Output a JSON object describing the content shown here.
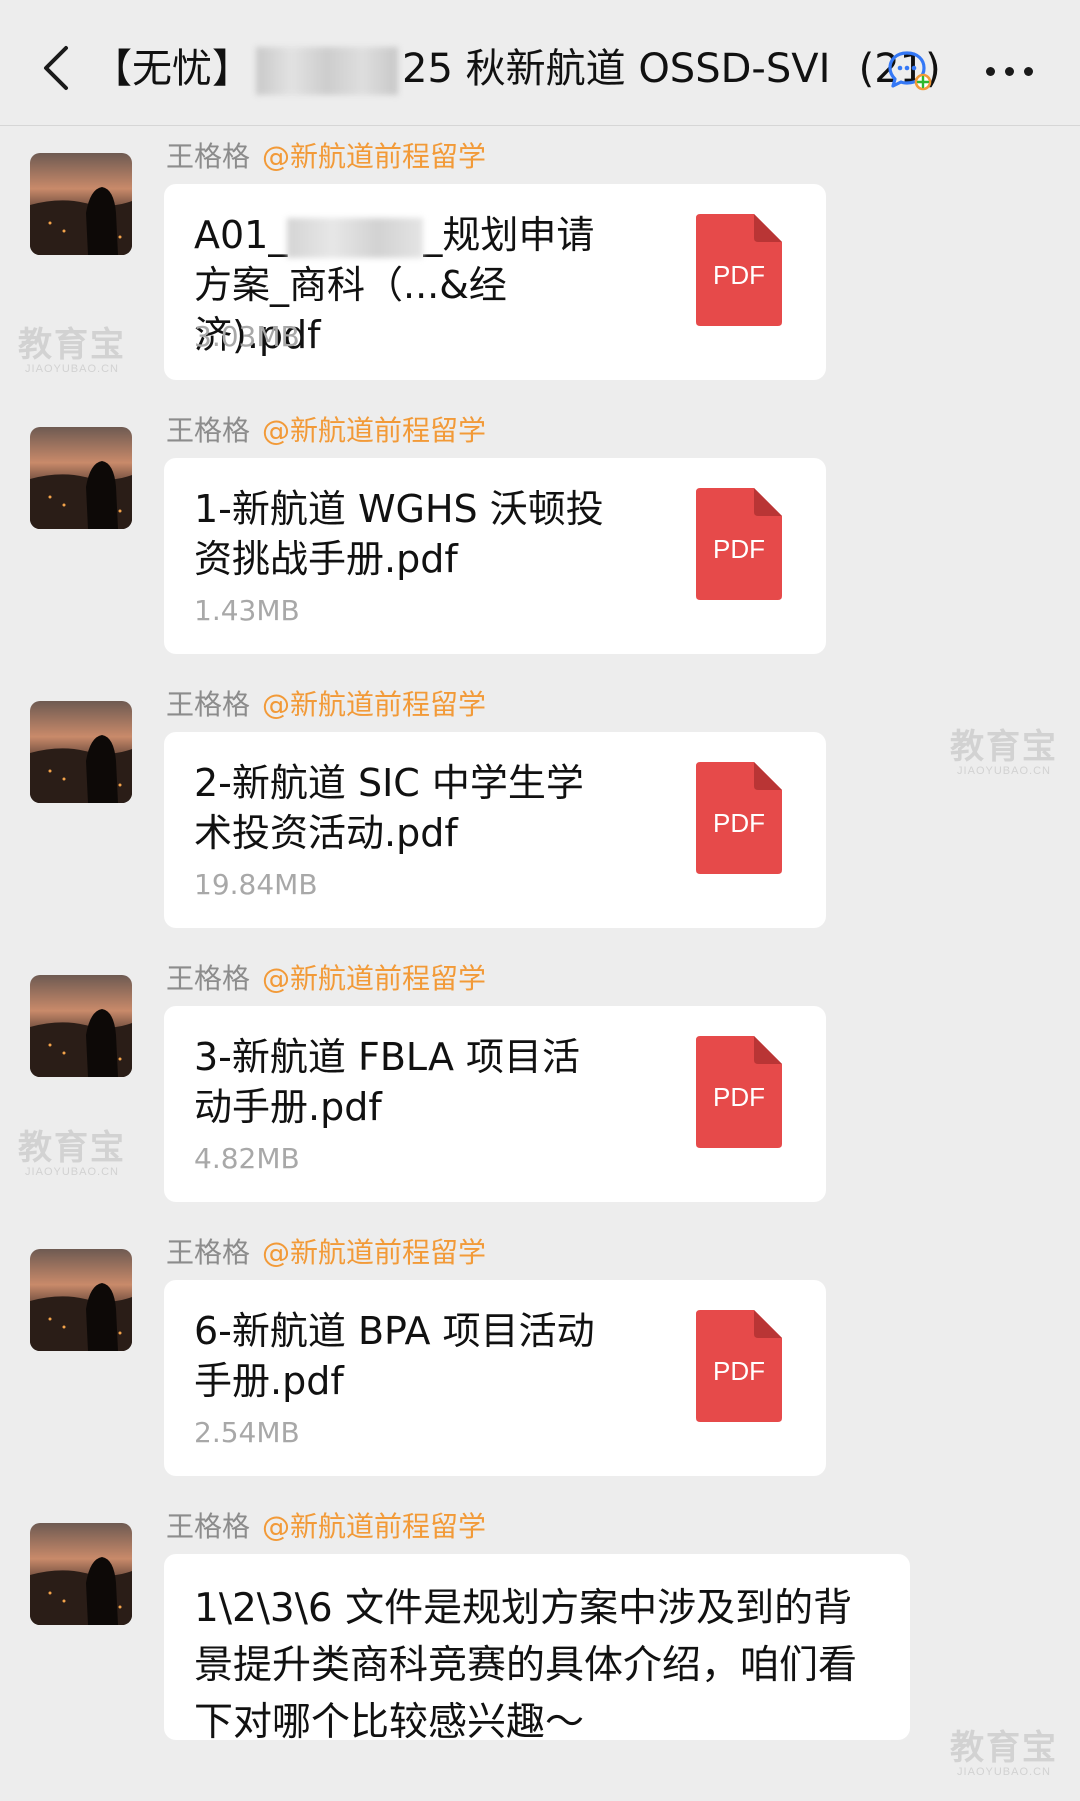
{
  "header": {
    "title_prefix": "【无忧】",
    "title_main": "25 秋新航道 OSSD-SV",
    "title_cut": "I",
    "member_count": "(21)"
  },
  "messages": [
    {
      "sender": "王格格",
      "company": "@新航道前程留学",
      "type": "file",
      "name_before": "A01_",
      "name_after": "_规划申请方案_商科（...&经济).pdf",
      "size": "3.03MB",
      "icon_label": "PDF"
    },
    {
      "sender": "王格格",
      "company": "@新航道前程留学",
      "type": "file",
      "name": "1-新航道 WGHS 沃顿投资挑战手册.pdf",
      "size": "1.43MB",
      "icon_label": "PDF"
    },
    {
      "sender": "王格格",
      "company": "@新航道前程留学",
      "type": "file",
      "name": "2-新航道 SIC 中学生学术投资活动.pdf",
      "size": "19.84MB",
      "icon_label": "PDF"
    },
    {
      "sender": "王格格",
      "company": "@新航道前程留学",
      "type": "file",
      "name": "3-新航道 FBLA 项目活动手册.pdf",
      "size": "4.82MB",
      "icon_label": "PDF"
    },
    {
      "sender": "王格格",
      "company": "@新航道前程留学",
      "type": "file",
      "name": "6-新航道 BPA 项目活动手册.pdf",
      "size": "2.54MB",
      "icon_label": "PDF"
    },
    {
      "sender": "王格格",
      "company": "@新航道前程留学",
      "type": "text",
      "text": "1\\2\\3\\6 文件是规划方案中涉及到的背景提升类商科竞赛的具体介绍，咱们看下对哪个比较感兴趣～"
    }
  ],
  "watermark": {
    "big": "教育宝",
    "small": "JIAOYUBAO.CN"
  },
  "icons": {
    "back": "chevron-left-icon",
    "chat": "chat-bubbles-icon",
    "more": "more-dots-icon",
    "file": "pdf-file-icon"
  },
  "colors": {
    "background": "#ededed",
    "company": "#f29a38",
    "pdf": "#e64a4a",
    "bubble": "#ffffff"
  }
}
